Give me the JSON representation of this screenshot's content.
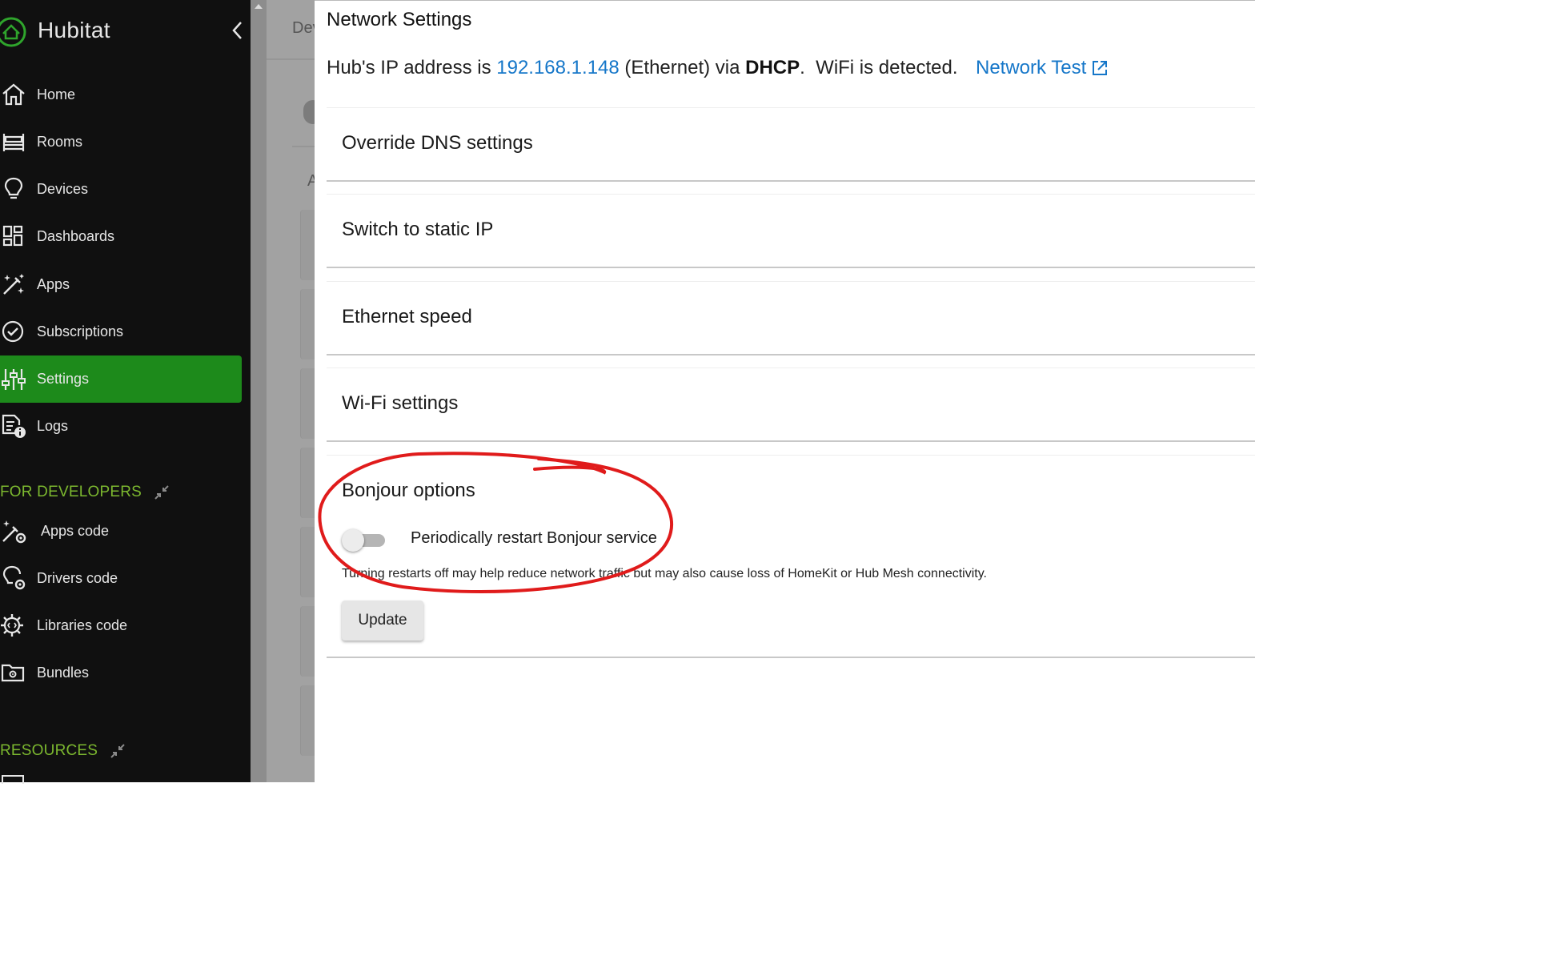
{
  "sidebar": {
    "brand": "Hubitat",
    "nav": [
      {
        "label": "Home",
        "icon": "home-icon"
      },
      {
        "label": "Rooms",
        "icon": "bed-icon"
      },
      {
        "label": "Devices",
        "icon": "lightbulb-icon"
      },
      {
        "label": "Dashboards",
        "icon": "dashboard-grid-icon"
      },
      {
        "label": "Apps",
        "icon": "magic-wand-icon"
      },
      {
        "label": "Subscriptions",
        "icon": "check-circle-icon"
      },
      {
        "label": "Settings",
        "icon": "sliders-icon",
        "active": true
      },
      {
        "label": "Logs",
        "icon": "log-info-icon"
      }
    ],
    "dev_section": "FOR DEVELOPERS",
    "dev_nav": [
      {
        "label": "Apps code",
        "icon": "wand-gear-icon"
      },
      {
        "label": "Drivers code",
        "icon": "bulb-gear-icon"
      },
      {
        "label": "Libraries code",
        "icon": "gear-code-icon"
      },
      {
        "label": "Bundles",
        "icon": "folder-gear-icon"
      }
    ],
    "resources_section": "RESOURCES"
  },
  "backdrop": {
    "ghost_text": "Dev",
    "ghost_letter": "A"
  },
  "dialog": {
    "title": "Network Settings",
    "ip_prefix": "Hub's IP address is",
    "ip_address": "192.168.1.148",
    "ip_middle": "(Ethernet) via",
    "ip_method": "DHCP",
    "ip_suffix": ".  WiFi is detected.",
    "network_test_label": "Network Test",
    "panels": [
      {
        "title": "Override DNS settings"
      },
      {
        "title": "Switch to static IP"
      },
      {
        "title": "Ethernet speed"
      },
      {
        "title": "Wi-Fi settings"
      }
    ],
    "bonjour": {
      "title": "Bonjour options",
      "toggle_label": "Periodically restart Bonjour service",
      "toggle_on": false,
      "helper": "Turning restarts off may help reduce network traffic but may also cause loss of HomeKit or Hub Mesh connectivity.",
      "update_label": "Update"
    }
  },
  "colors": {
    "sidebar_bg": "#101010",
    "active_item": "#1d8a1b",
    "section_head": "#7cb82f",
    "link": "#1677c9",
    "annotation": "#e01b1b"
  }
}
